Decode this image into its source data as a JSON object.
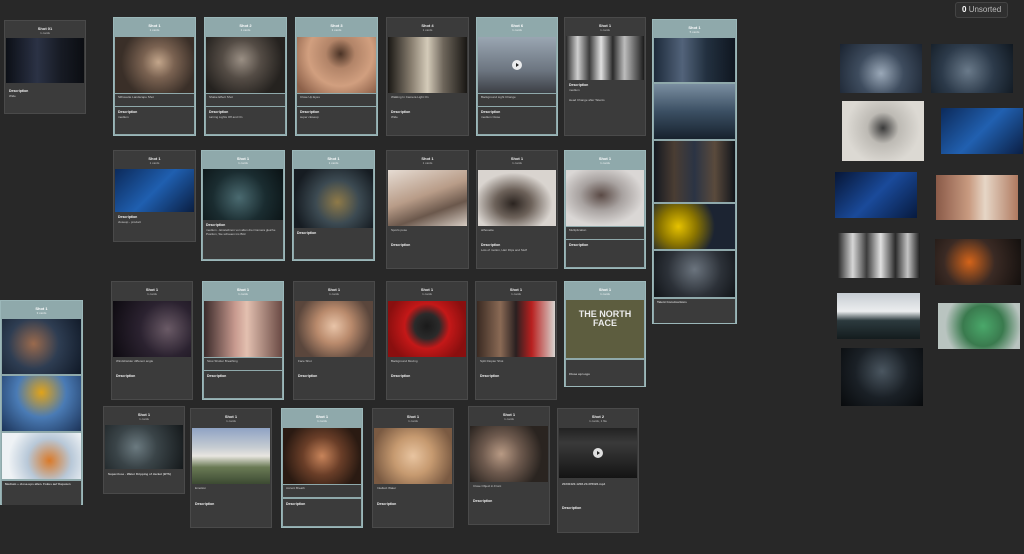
{
  "unsorted": {
    "count": "0",
    "label": "Unsorted"
  },
  "shots": {
    "s01": {
      "title": "Shot 01",
      "sub": "1 cards",
      "desc_label": "Description",
      "desc": "Wide"
    },
    "r1c1": {
      "title": "Shot 1",
      "sub": "1 cards",
      "caption": "Silhouette Landscape Shot",
      "desc_label": "Description",
      "desc": "medium"
    },
    "r1c2": {
      "title": "Shot 2",
      "sub": "1 cards",
      "caption": "Shake Effect Shot",
      "desc_label": "Description",
      "desc": "turning Lights Off and On"
    },
    "r1c3": {
      "title": "Shot 3",
      "sub": "1 cards",
      "caption": "Close Up Eyes",
      "desc_label": "Description",
      "desc": "super closeup"
    },
    "r1c4": {
      "title": "Shot 4",
      "sub": "1 cards",
      "caption": "Walking In Camera Light On",
      "desc_label": "Description",
      "desc": "Wide"
    },
    "r1c5": {
      "title": "Shot 6",
      "sub": "1 cards",
      "caption": "Background Light Change",
      "desc_label": "Description",
      "desc": "medium Close"
    },
    "r1c6": {
      "title": "Shot 1",
      "sub": "1 cards",
      "desc_label": "Description",
      "desc": "medium",
      "extra": "Head Change after Talents"
    },
    "talent": {
      "title": "Shot 1",
      "sub": "5 cards",
      "caption": "Talent Constructions"
    },
    "r2c1": {
      "title": "Shot 1",
      "sub": "1 cards",
      "desc_label": "Description",
      "desc": "closeup - product"
    },
    "r2c2": {
      "title": "Shot 1",
      "sub": "1 cards",
      "desc_label": "Description",
      "desc": "medium - Einstellmon von allen drei Camera gleiche Position, Sie schauen ins Bild"
    },
    "r2c3": {
      "title": "Shot 1",
      "sub": "1 cards",
      "desc_label": "Description",
      "desc": ""
    },
    "r2c4": {
      "title": "Shot 1",
      "sub": "1 cards",
      "caption": "Sports pose",
      "desc_label": "Description",
      "desc": ""
    },
    "r2c5": {
      "title": "Shot 1",
      "sub": "1 cards",
      "caption": "silhouette",
      "desc_label": "Description",
      "desc": "Lots of motion, Hair Flips and Stuff"
    },
    "r2c6": {
      "title": "Shot 1",
      "sub": "1 cards",
      "caption": "Multiplication",
      "desc_label": "Description",
      "desc": ""
    },
    "left": {
      "title": "Shot 1",
      "sub": "3 cards",
      "desc": "Medium + close-ups allen. Fokus auf Kapuzen"
    },
    "r3c1": {
      "title": "Shot 1",
      "sub": "1 cards",
      "caption": "Windshielder different angle",
      "desc_label": "Description",
      "desc": ""
    },
    "r3c2": {
      "title": "Shot 1",
      "sub": "1 cards",
      "caption": "Slow Shutter Breathing",
      "desc_label": "Description",
      "desc": ""
    },
    "r3c3": {
      "title": "Shot 1",
      "sub": "1 cards",
      "caption": "Face Shot",
      "desc_label": "Description",
      "desc": ""
    },
    "r3c4": {
      "title": "Shot 1",
      "sub": "1 cards",
      "caption": "Background Moving",
      "desc_label": "Description",
      "desc": ""
    },
    "r3c5": {
      "title": "Shot 1",
      "sub": "1 cards",
      "caption": "Split Diopter Shot",
      "desc_label": "Description",
      "desc": ""
    },
    "r3c6": {
      "title": "Shot 1",
      "sub": "1 cards",
      "logo_text": "THE NORTH FACE",
      "caption": "Close up Logo"
    },
    "r4c1": {
      "title": "Shot 1",
      "sub": "1 cards",
      "desc": "Superclose - Water Dripping of Jacket (BTS)"
    },
    "r4c2": {
      "title": "Shot 1",
      "sub": "1 cards",
      "caption": "Emotion",
      "desc_label": "Description",
      "desc": ""
    },
    "r4c3": {
      "title": "Shot 1",
      "sub": "1 cards",
      "caption": "Accent Breath",
      "desc_label": "Description",
      "desc": ""
    },
    "r4c4": {
      "title": "Shot 1",
      "sub": "1 cards",
      "caption": "Intellect Water",
      "desc_label": "Description",
      "desc": ""
    },
    "r4c5": {
      "title": "Shot 1",
      "sub": "1 cards",
      "caption": "Close Object in Front",
      "desc_label": "Description",
      "desc": ""
    },
    "r4c6": {
      "title": "Shot 2",
      "sub": "1 cards, 1 file",
      "file": "20230422-1208-20.376022.mp4",
      "desc_label": "Description",
      "desc": ""
    }
  },
  "colors": {
    "background": "#282828",
    "card": "#3b3b3b",
    "highlight_card": "#8fa9ab",
    "text": "#f0f0f0"
  }
}
